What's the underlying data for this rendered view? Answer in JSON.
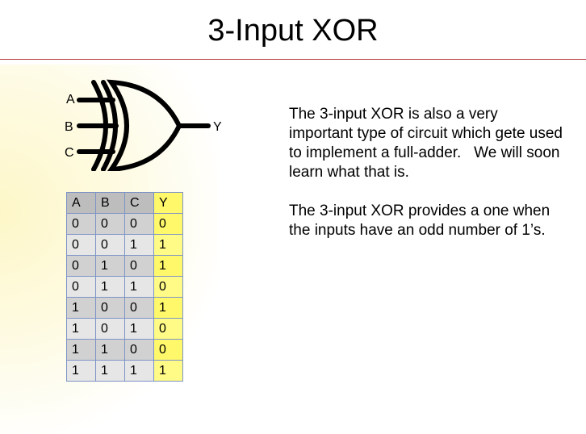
{
  "slide": {
    "title": "3-Input XOR"
  },
  "gate": {
    "inputs": [
      "A",
      "B",
      "C"
    ],
    "output": "Y"
  },
  "truth_table": {
    "headers": [
      "A",
      "B",
      "C",
      "Y"
    ],
    "rows": [
      [
        "0",
        "0",
        "0",
        "0"
      ],
      [
        "0",
        "0",
        "1",
        "1"
      ],
      [
        "0",
        "1",
        "0",
        "1"
      ],
      [
        "0",
        "1",
        "1",
        "0"
      ],
      [
        "1",
        "0",
        "0",
        "1"
      ],
      [
        "1",
        "0",
        "1",
        "0"
      ],
      [
        "1",
        "1",
        "0",
        "0"
      ],
      [
        "1",
        "1",
        "1",
        "1"
      ]
    ]
  },
  "body": {
    "paragraph_1": "The 3-input XOR is also a very important type of circuit which gete used to implement a full-adder.   We will soon learn what that is.",
    "paragraph_2": "The 3-input XOR provides a one when the inputs have an odd number of 1’s."
  },
  "colors": {
    "title_rule": "#b3333a",
    "output_column": "#fff86a",
    "table_border": "#7d93c6"
  }
}
